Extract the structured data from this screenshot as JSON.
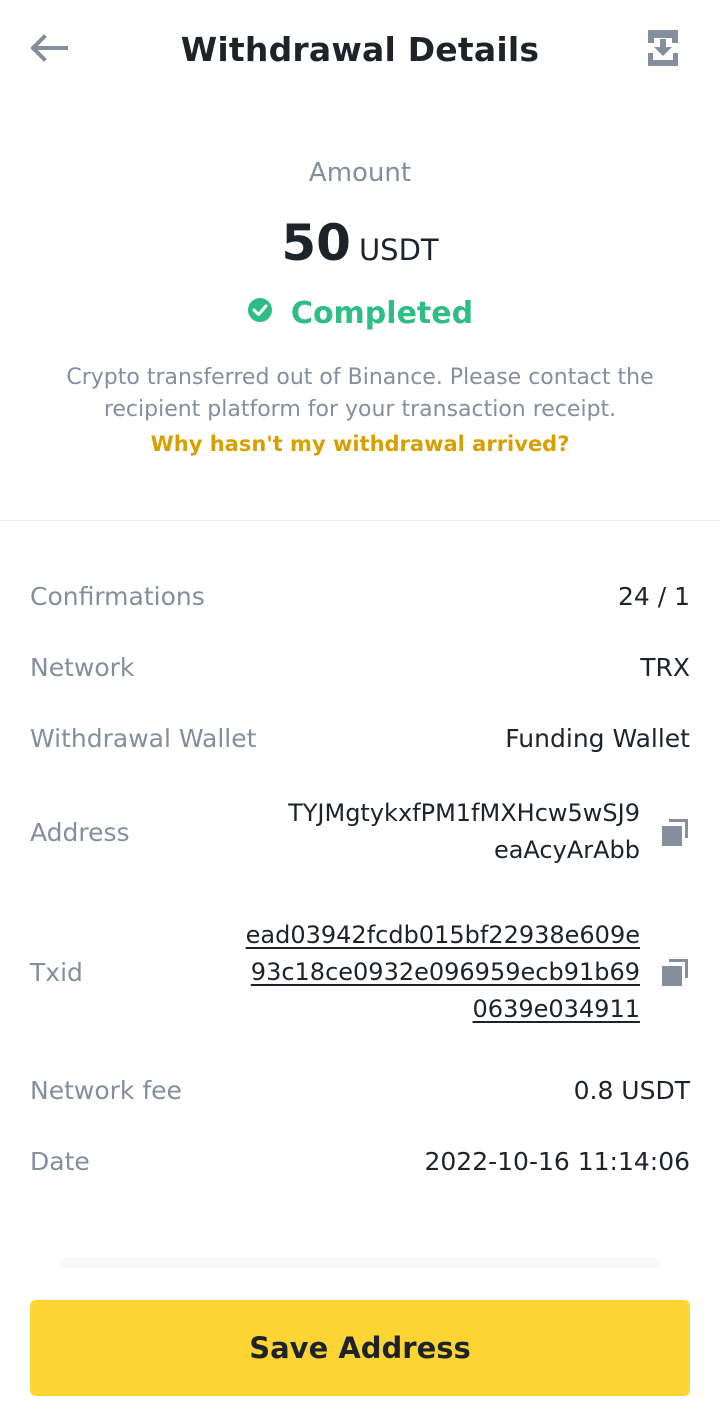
{
  "header": {
    "title": "Withdrawal Details",
    "back_icon": "arrow-left-icon",
    "download_icon": "download-icon"
  },
  "summary": {
    "amount_label": "Amount",
    "amount_value": "50",
    "amount_unit": "USDT",
    "status": "Completed",
    "status_icon": "check-circle-icon",
    "info_text": "Crypto transferred out of Binance. Please contact the recipient platform for your transaction receipt.",
    "help_link": "Why hasn't my withdrawal arrived?"
  },
  "details": {
    "confirmations_label": "Confirmations",
    "confirmations_value": "24 / 1",
    "network_label": "Network",
    "network_value": "TRX",
    "wallet_label": "Withdrawal Wallet",
    "wallet_value": "Funding Wallet",
    "address_label": "Address",
    "address_line1": "TYJMgtykxfPM1fMXHcw5wSJ9",
    "address_line2": "eaAcyArAbb",
    "txid_label": "Txid",
    "txid_line1": "ead03942fcdb015bf22938e609e",
    "txid_line2": "93c18ce0932e096959ecb91b69",
    "txid_line3": "0639e034911",
    "fee_label": "Network fee",
    "fee_value": "0.8 USDT",
    "date_label": "Date",
    "date_value": "2022-10-16 11:14:06"
  },
  "actions": {
    "save_address": "Save Address"
  },
  "colors": {
    "accent": "#fcd535",
    "success": "#2ebd85",
    "link": "#d89f00",
    "muted": "#848e9c",
    "text": "#1e2329"
  }
}
